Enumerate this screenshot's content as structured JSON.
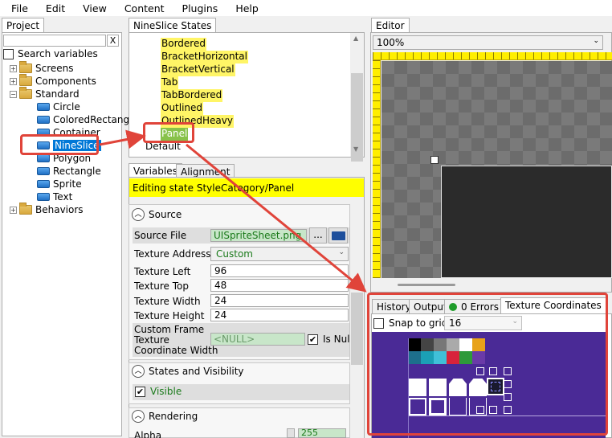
{
  "menu": [
    "File",
    "Edit",
    "View",
    "Content",
    "Plugins",
    "Help"
  ],
  "project": {
    "tab_label": "Project",
    "clear_label": "X",
    "search_variables_label": "Search variables",
    "tree": {
      "screens": "Screens",
      "components": "Components",
      "standard": "Standard",
      "standard_items": [
        "Circle",
        "ColoredRectangle",
        "Container",
        "NineSlice",
        "Polygon",
        "Rectangle",
        "Sprite",
        "Text"
      ],
      "behaviors": "Behaviors"
    }
  },
  "states": {
    "tab_label": "NineSlice States",
    "items": [
      "Bordered",
      "BracketHorizontal",
      "BracketVertical",
      "Tab",
      "TabBordered",
      "Outlined",
      "OutlinedHeavy",
      "Panel"
    ],
    "default_label": "Default"
  },
  "variables": {
    "tabs": [
      "Variables",
      "Alignment"
    ],
    "editing_banner": "Editing state StyleCategory/Panel",
    "source": {
      "header": "Source",
      "source_file_label": "Source File",
      "source_file_value": "UISpriteSheet.png",
      "browse_label": "...",
      "texture_address_label": "Texture Address",
      "texture_address_value": "Custom",
      "texture_left_label": "Texture Left",
      "texture_left_value": "96",
      "texture_top_label": "Texture Top",
      "texture_top_value": "48",
      "texture_width_label": "Texture Width",
      "texture_width_value": "24",
      "texture_height_label": "Texture Height",
      "texture_height_value": "24",
      "custom_frame_label_1": "Custom Frame",
      "custom_frame_label_2": "Texture",
      "custom_frame_label_3": "Coordinate Width",
      "custom_frame_value": "<NULL>",
      "is_null_label": "Is Null"
    },
    "states_visibility": {
      "header": "States and Visibility",
      "visible_label": "Visible"
    },
    "rendering": {
      "header": "Rendering",
      "alpha_label": "Alpha",
      "alpha_value": "255"
    }
  },
  "editor": {
    "tab_label": "Editor",
    "zoom": "100%"
  },
  "bottom": {
    "tabs": [
      "History",
      "Output",
      "0 Errors",
      "Texture Coordinates"
    ],
    "snap_label": "Snap to grid",
    "snap_value": "16"
  },
  "colors": {
    "annotation_red": "#e0443a",
    "highlight_yellow": "#fff566",
    "selection_blue": "#0078d7",
    "texture_bg": "#4a2a96",
    "error_green": "#1f9c2a"
  }
}
